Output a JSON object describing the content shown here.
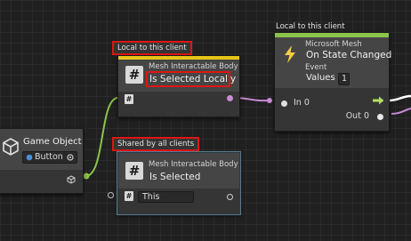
{
  "captions": {
    "local_node1": "Local to this client",
    "shared_node2": "Shared by all clients",
    "local_event_node": "Local to this client"
  },
  "game_object_node": {
    "title": "Game Object",
    "value": "Button"
  },
  "interactable_node_local": {
    "subtitle": "Mesh Interactable Body",
    "title": "Is Selected Locally"
  },
  "interactable_node_shared": {
    "subtitle": "Mesh Interactable Body",
    "title": "Is Selected",
    "input_value": "This"
  },
  "event_node": {
    "line1": "Microsoft Mesh",
    "line2": "On State Changed",
    "line3": "Event",
    "values_label": "Values",
    "values_count": "1",
    "in_port_label": "In 0",
    "out_port_label": "Out 0"
  },
  "colors": {
    "header_yellow": "#e8c317",
    "header_green": "#8bc34a",
    "highlight_red": "#e01515",
    "wire_green": "#8bc34a",
    "wire_magenta": "#c98ad6"
  }
}
